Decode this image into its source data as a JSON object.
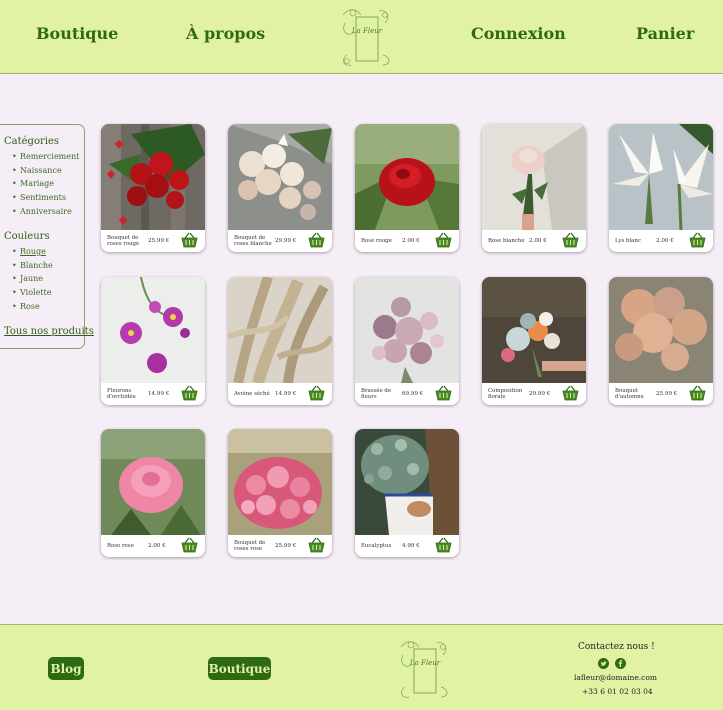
{
  "header": {
    "nav": [
      "Boutique",
      "À propos",
      "Connexion",
      "Panier"
    ],
    "logo_text": "La Fleur"
  },
  "sidebar": {
    "categories_title": "Catégories",
    "categories": [
      "Remerciement",
      "Naissance",
      "Mariage",
      "Sentiments",
      "Anniversaire"
    ],
    "colors_title": "Couleurs",
    "colors": [
      "Rouge",
      "Blanche",
      "Jaune",
      "Violette",
      "Rose"
    ],
    "colors_active": "Rouge",
    "all_products": "Tous nos produits"
  },
  "products": [
    {
      "name": "Bouquet de roses rouge",
      "price": "25.99 €",
      "photo": "red-roses-bouquet"
    },
    {
      "name": "Bouquet de roses blanche",
      "price": "29.99 €",
      "photo": "white-roses-bouquet"
    },
    {
      "name": "Rose rouge",
      "price": "2.00 €",
      "photo": "red-rose"
    },
    {
      "name": "Rose blanche",
      "price": "2.00 €",
      "photo": "white-rose"
    },
    {
      "name": "Lys blanc",
      "price": "2.00 €",
      "photo": "white-lily"
    },
    {
      "name": "Fleurons d'orchidée",
      "price": "14.99 €",
      "photo": "orchid"
    },
    {
      "name": "Avoine séché",
      "price": "14.99 €",
      "photo": "dried-oats"
    },
    {
      "name": "Brassée de fleurs",
      "price": "69.99 €",
      "photo": "flower-armful"
    },
    {
      "name": "Composition florale",
      "price": "29.99 €",
      "photo": "floral-composition"
    },
    {
      "name": "Bouquet d'automne",
      "price": "25.99 €",
      "photo": "autumn-bouquet"
    },
    {
      "name": "Rose rose",
      "price": "2.00 €",
      "photo": "pink-rose"
    },
    {
      "name": "Bouquet de roses rose",
      "price": "25.99 €",
      "photo": "pink-roses-bouquet"
    },
    {
      "name": "Eucalyptus",
      "price": "4.99 €",
      "photo": "eucalyptus"
    }
  ],
  "footer": {
    "blog": "Blog",
    "boutique": "Boutique",
    "contact_title": "Contactez nous !",
    "socials": [
      "twitter-icon",
      "facebook-icon"
    ],
    "email": "lafleur@domaine.com",
    "phone": "+33 6 01 02 03 04"
  },
  "colors": {
    "header_bg": "#e2f2a4",
    "accent_green": "#2e6a14",
    "page_bg": "#f6eef6"
  }
}
